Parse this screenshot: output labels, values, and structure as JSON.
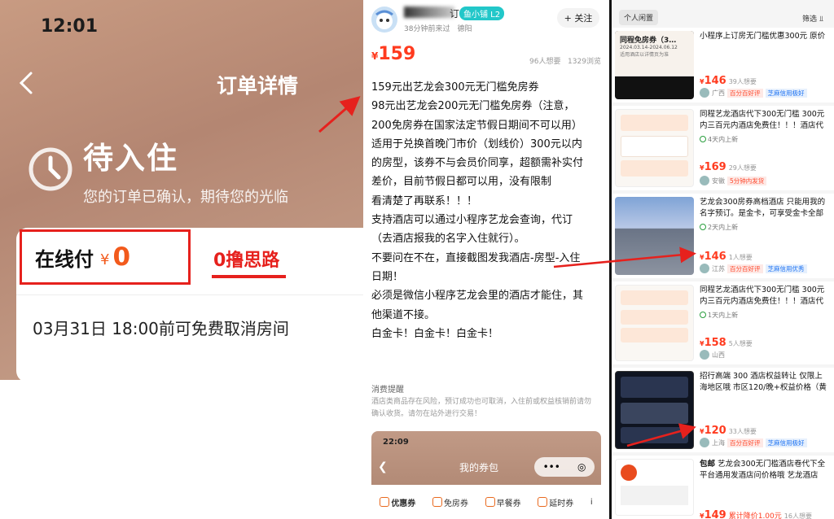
{
  "left": {
    "status_bar_time": "12:01",
    "title": "订单详情",
    "status": "待入住",
    "subtitle": "您的订单已确认，期待您的光临",
    "pay_label": "在线付",
    "currency": "¥",
    "pay_value": "0",
    "annotation": "0撸思路",
    "cancel_note": "03月31日 18:00前可免费取消房间"
  },
  "middle": {
    "username_tail": "订",
    "badge": "鱼小铺 L2",
    "meta": "38分钟前来过　德阳",
    "follow_label": "+ 关注",
    "currency": "¥",
    "price": "159",
    "want": "96人想要",
    "views": "1329浏览",
    "description": [
      "159元出艺龙会300元无门槛免房券",
      "98元出艺龙会200元无门槛免房券（注意，",
      "200免房券在国家法定节假日期间不可以用）",
      "适用于兑换首晚门市价（划线价）300元以内",
      "的房型，该券不与会员价同享，超额需补实付",
      "差价，目前节假日都可以用，没有限制",
      "看清楚了再联系！！！",
      "支持酒店可以通过小程序艺龙会查询，代订",
      "（去酒店报我的名字入住就行）。",
      "不要问在不在，直接截图发我酒店-房型-入住",
      "日期！",
      "必须是微信小程序艺龙会里的酒店才能住，其",
      "他渠道不接。",
      "白金卡！白金卡！白金卡！"
    ],
    "notice_title": "消费提醒",
    "notice_text": "酒店类商品存在风险，预订成功也可取消，入住前或权益核销前请勿确认收货。请勿在站外进行交易！",
    "phone": {
      "time": "22:09",
      "title": "我的券包",
      "more": "•••",
      "target": "◎",
      "tabs": [
        "优惠券",
        "免房券",
        "早餐券",
        "延时券",
        "i"
      ]
    }
  },
  "right": {
    "tab": "个人闲置",
    "filter": "筛选",
    "items": [
      {
        "thumb_title": "同程免房券（3…",
        "thumb_date": "2024.03.14-2024.06.12",
        "thumb_sub": "适用酒店以详情页为准",
        "title": "小程序上订房无门槛优惠300元 原价",
        "tag": "",
        "price": "146",
        "want": "39人想要",
        "loc": "广西",
        "b1": "百分百好评",
        "b2": "芝麻信用极好",
        "label": ""
      },
      {
        "thumb_title": "",
        "title": "同程艺龙酒店代下300无门槛 300元内三百元内酒店免费住！！！酒店代",
        "tag": "4天内上新",
        "price": "169",
        "want": "29人想要",
        "loc": "安徽",
        "b1": "5分钟内发货",
        "b2": "",
        "label": ""
      },
      {
        "thumb_title": "",
        "title": "艺龙会300房券高档酒店 只能用我的名字预订。是金卡，可享受金卡全部",
        "tag": "2天内上新",
        "price": "146",
        "want": "1人想要",
        "loc": "江苏",
        "b1": "百分百好评",
        "b2": "芝麻信用优秀",
        "label": ""
      },
      {
        "thumb_title": "",
        "title": "同程艺龙酒店代下300无门槛 300元内三百元内酒店免费住！！！酒店代",
        "tag": "1天内上新",
        "price": "158",
        "want": "5人想要",
        "loc": "山西",
        "b1": "",
        "b2": "",
        "label": ""
      },
      {
        "thumb_title": "",
        "title": "招行高端 300 酒店权益转让 仅限上海地区哦 市区120/晚+权益价格（黄",
        "tag": "",
        "price": "120",
        "want": "33人想要",
        "loc": "上海",
        "b1": "百分百好评",
        "b2": "芝麻信用极好",
        "label": ""
      },
      {
        "thumb_title": "",
        "title_prefix": "包邮",
        "title": " 艺龙会300无门槛酒店卷代下全平台通用发酒店问价格哦 艺龙酒店",
        "tag": "",
        "price": "149",
        "want": "16人想要",
        "loc": "",
        "b1": "",
        "b2": "",
        "label": "累计降价1.00元"
      }
    ]
  },
  "colors": {
    "accent_red": "#e6211d",
    "price_orange": "#ff3b1f",
    "brand_brown": "#b48672"
  }
}
